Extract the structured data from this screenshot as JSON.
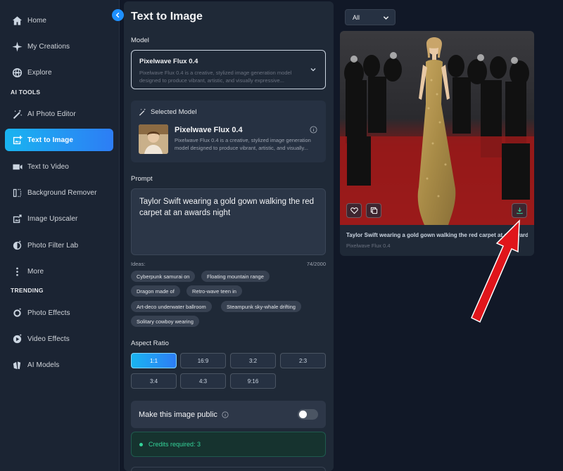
{
  "sidebar": {
    "nav": [
      {
        "label": "Home",
        "icon": "home-icon"
      },
      {
        "label": "My Creations",
        "icon": "sparkle-icon"
      },
      {
        "label": "Explore",
        "icon": "globe-icon"
      }
    ],
    "ai_tools_label": "AI TOOLS",
    "ai_tools": [
      {
        "label": "AI Photo Editor",
        "icon": "magic-wand-icon"
      },
      {
        "label": "Text to Image",
        "icon": "image-plus-icon",
        "active": true
      },
      {
        "label": "Text to Video",
        "icon": "video-icon"
      },
      {
        "label": "Background Remover",
        "icon": "background-remove-icon"
      },
      {
        "label": "Image Upscaler",
        "icon": "upscale-icon"
      },
      {
        "label": "Photo Filter Lab",
        "icon": "filter-icon"
      },
      {
        "label": "More",
        "icon": "more-vertical-icon"
      }
    ],
    "trending_label": "TRENDING",
    "trending": [
      {
        "label": "Photo Effects",
        "icon": "photo-effects-icon"
      },
      {
        "label": "Video Effects",
        "icon": "video-effects-icon"
      },
      {
        "label": "AI Models",
        "icon": "models-icon"
      }
    ]
  },
  "panel": {
    "title": "Text to Image",
    "model_label": "Model",
    "model_select": {
      "name": "Pixelwave Flux 0.4",
      "description": "Pixelwave Flux 0.4 is a creative, stylized image generation model designed to produce vibrant, artistic, and visually expressive..."
    },
    "selected_model": {
      "header": "Selected Model",
      "name": "Pixelwave Flux 0.4",
      "description": "Pixelwave Flux 0.4 is a creative, stylized image generation model designed to produce vibrant, artistic, and visually..."
    },
    "prompt_label": "Prompt",
    "prompt_value": "Taylor Swift wearing a gold gown walking the red carpet at an awards night",
    "ideas_label": "Ideas:",
    "char_count": "74/2000",
    "ideas": [
      "Cyberpunk samurai on",
      "Floating mountain range",
      "Dragon made of",
      "Retro-wave teen in",
      "Art-deco underwater ballroom",
      "Steampunk sky-whale drifting",
      "Solitary cowboy wearing"
    ],
    "aspect_label": "Aspect Ratio",
    "aspect_ratios": [
      "1:1",
      "16:9",
      "3:2",
      "2:3",
      "3:4",
      "4:3",
      "9:16"
    ],
    "aspect_selected": "1:1",
    "public_label": "Make this image public",
    "public_on": false,
    "credits_text": "Credits required: 3"
  },
  "gallery": {
    "filter_value": "All",
    "item": {
      "caption": "Taylor Swift wearing a gold gown walking the red carpet at an awards night",
      "model": "Pixelwave Flux 0.4"
    }
  },
  "colors": {
    "accent": "#2d7df5",
    "accent_start": "#19b4f0",
    "success": "#34d399",
    "annotation_arrow": "#e0151b"
  }
}
